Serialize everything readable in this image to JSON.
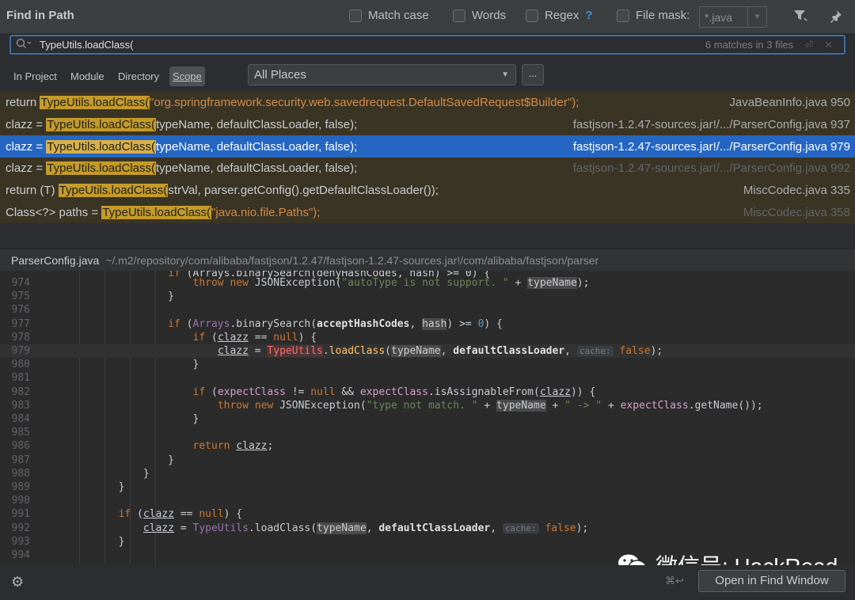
{
  "header": {
    "title": "Find in Path",
    "match_case": "Match case",
    "words": "Words",
    "regex": "Regex",
    "regex_help": "?",
    "file_mask_label": "File mask:",
    "file_mask_value": "*.java"
  },
  "search": {
    "query": "TypeUtils.loadClass(",
    "match_count": "6 matches in 3 files"
  },
  "scope": {
    "tabs": [
      "In Project",
      "Module",
      "Directory",
      "Scope"
    ],
    "selected": "Scope",
    "places": "All Places",
    "more": "..."
  },
  "results": [
    {
      "before": "return ",
      "match": "TypeUtils.loadClass(",
      "after": "\"org.springframework.security.web.savedrequest.DefaultSavedRequest$Builder\");",
      "location": "JavaBeanInfo.java 950"
    },
    {
      "before": "clazz = ",
      "match": "TypeUtils.loadClass(",
      "after": "typeName, defaultClassLoader, false);",
      "location": "fastjson-1.2.47-sources.jar!/.../ParserConfig.java 937"
    },
    {
      "before": "clazz = ",
      "match": "TypeUtils.loadClass(",
      "after": "typeName, defaultClassLoader, false);",
      "location": "fastjson-1.2.47-sources.jar!/.../ParserConfig.java 979"
    },
    {
      "before": "clazz = ",
      "match": "TypeUtils.loadClass(",
      "after": "typeName, defaultClassLoader, false);",
      "location": "fastjson-1.2.47-sources.jar!/.../ParserConfig.java 992"
    },
    {
      "before": "return (T) ",
      "match": "TypeUtils.loadClass(",
      "after": "strVal, parser.getConfig().getDefaultClassLoader());",
      "location": "MiscCodec.java 335"
    },
    {
      "before": "Class<?> paths = ",
      "match": "TypeUtils.loadClass(",
      "after": "\"java.nio.file.Paths\");",
      "location": "MiscCodec.java 358"
    }
  ],
  "selected_result": 2,
  "preview": {
    "file": "ParserConfig.java",
    "path": "~/.m2/repository/com/alibaba/fastjson/1.2.47/fastjson-1.2.47-sources.jar!/com/alibaba/fastjson/parser",
    "line_numbers": [
      "974",
      "975",
      "976",
      "977",
      "978",
      "979",
      "980",
      "981",
      "982",
      "983",
      "984",
      "985",
      "986",
      "987",
      "988",
      "989",
      "990",
      "991",
      "992",
      "993",
      "994"
    ]
  },
  "footer": {
    "shortcut": "⌘↩",
    "open_button": "Open in Find Window",
    "watermark": "微信号: HackRead"
  },
  "colors": {
    "selection": "#2566c2",
    "match_highlight": "#c49b2a",
    "search_border": "#3d6fa3"
  }
}
